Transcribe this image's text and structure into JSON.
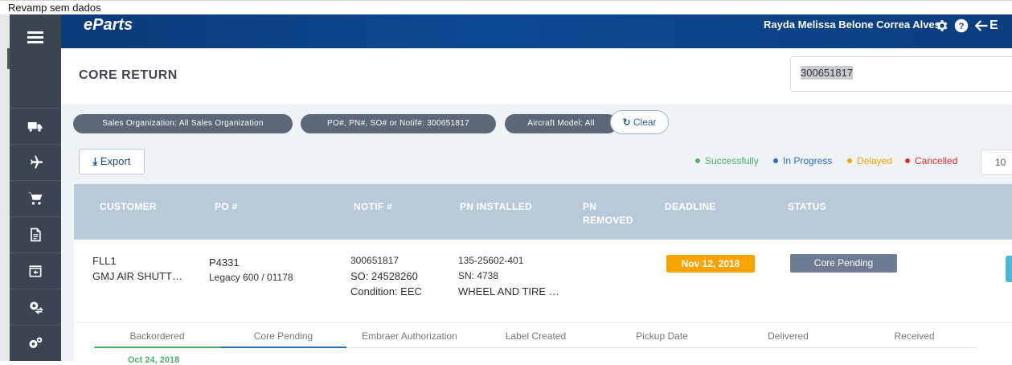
{
  "window": {
    "title": "Revamp  sem dados"
  },
  "topbar": {
    "logo": "eParts",
    "user_name": "Rayda Melissa Belone Correa Alves",
    "exit_label": "E"
  },
  "page": {
    "title": "CORE RETURN"
  },
  "search": {
    "value": "300651817"
  },
  "filters": {
    "chips": [
      "Sales Organization: All Sales Organization",
      "PO#, PN#, SO# or Notif#: 300651817",
      "Aircraft Model: All"
    ],
    "clear_label": "Clear"
  },
  "toolbar": {
    "export_label": "Export",
    "page_size": "10"
  },
  "legend": [
    {
      "label": "Successfully",
      "color": "#4caf6a"
    },
    {
      "label": "In Progress",
      "color": "#2f6cbf"
    },
    {
      "label": "Delayed",
      "color": "#f9a400"
    },
    {
      "label": "Cancelled",
      "color": "#e02a2a"
    }
  ],
  "table": {
    "columns": [
      "CUSTOMER",
      "PO #",
      "NOTIF #",
      "PN INSTALLED",
      "PN REMOVED",
      "DEADLINE",
      "STATUS"
    ],
    "rows": [
      {
        "customer_code": "FLL1",
        "customer_name": "GMJ AIR SHUTT…",
        "po": "P4331",
        "po_detail": "Legacy 600 / 01178",
        "notif": "300651817",
        "so": "SO: 24528260",
        "condition": "Condition: EEC",
        "pn_installed": "135-25602-401",
        "sn": "SN: 4738",
        "pn_desc": "WHEEL AND TIRE …",
        "deadline": "Nov 12, 2018",
        "status": "Core Pending"
      }
    ]
  },
  "steps": {
    "labels": [
      "Backordered",
      "Core Pending",
      "Embraer Authorization",
      "Label Created",
      "Pickup Date",
      "Delivered",
      "Received"
    ],
    "first_date": "Oct 24, 2018"
  },
  "icons": {
    "menu": "hamburger-icon",
    "nav": [
      "truck-icon",
      "airplane-icon",
      "cart-icon",
      "document-icon",
      "return-box-icon",
      "gear-exchange-icon",
      "gears-icon"
    ],
    "top": [
      "gear-icon",
      "help-icon",
      "exit-arrow-icon"
    ]
  }
}
